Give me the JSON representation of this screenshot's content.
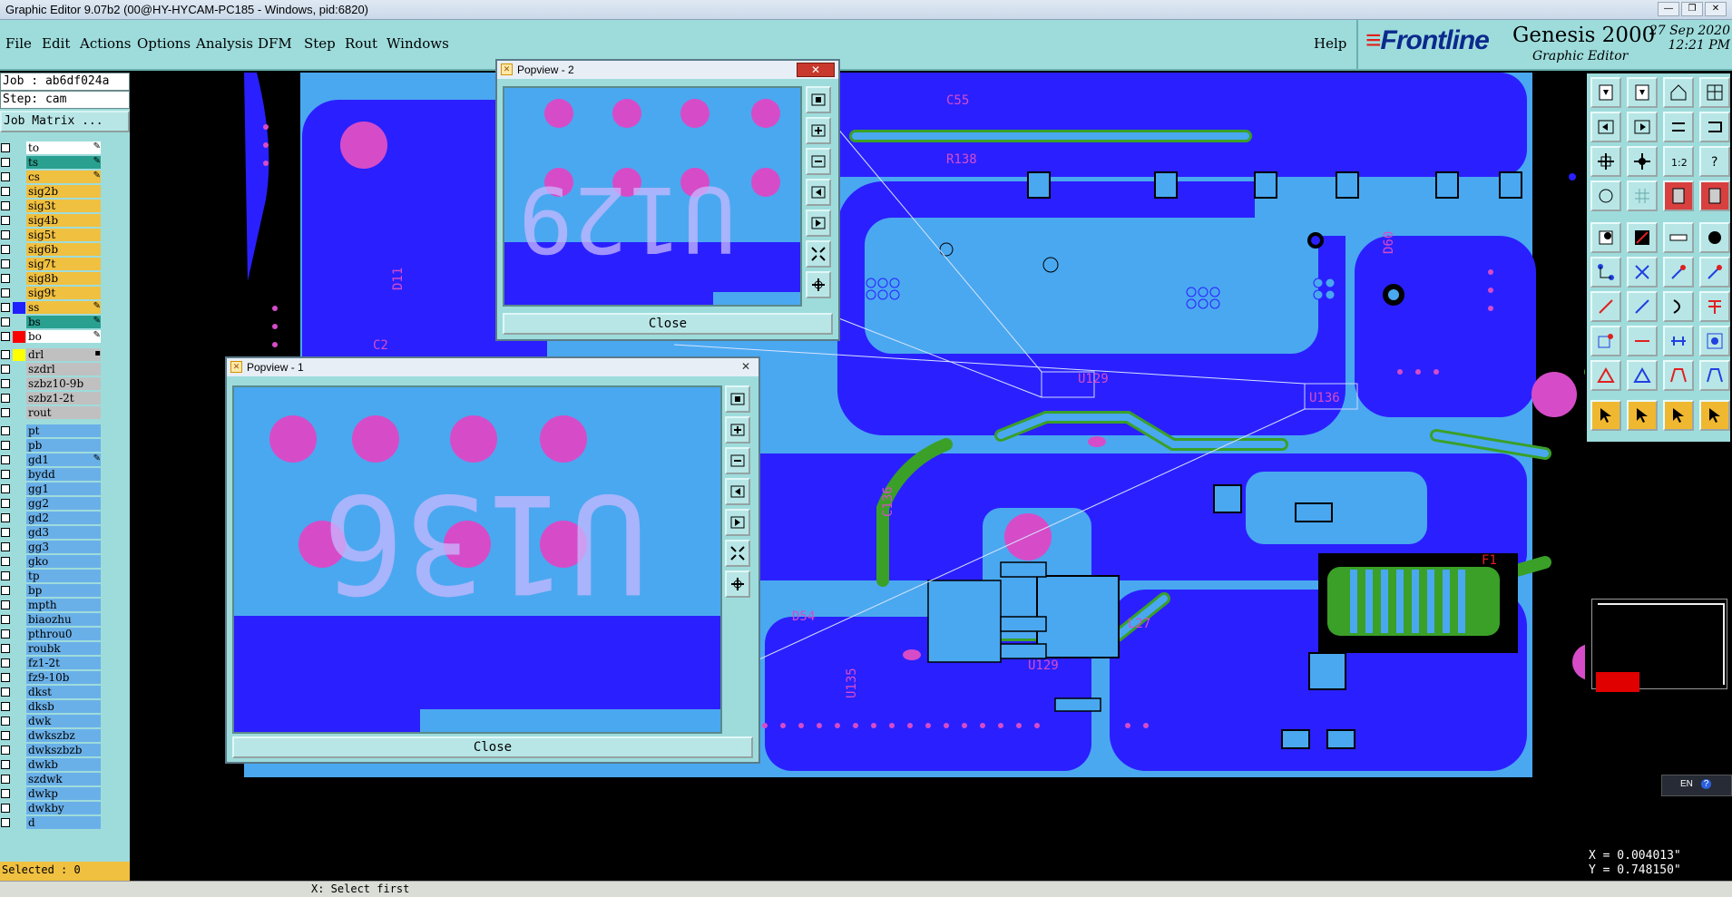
{
  "window_title": "Graphic Editor 9.07b2 (00@HY-HYCAM-PC185 - Windows, pid:6820)",
  "menu": {
    "file": "File",
    "edit": "Edit",
    "actions": "Actions",
    "options": "Options",
    "analysis": "Analysis",
    "dfm": "DFM",
    "step": "Step",
    "rout": "Rout",
    "windows": "Windows",
    "help": "Help"
  },
  "brand": {
    "logo_a": "Fr",
    "logo_b": "ontline",
    "product": "Genesis 2000",
    "subtitle": "Graphic Editor",
    "date": "27 Sep 2020",
    "time": "12:21 PM"
  },
  "left": {
    "job": "Job : ab6df024a",
    "step": "Step: cam",
    "job_matrix": "Job Matrix ...",
    "selected": "Selected : 0"
  },
  "layers": [
    {
      "name": "to",
      "swatch": "",
      "bg": "#ffffff",
      "mark": "✎"
    },
    {
      "name": "ts",
      "swatch": "",
      "bg": "#2aa090",
      "mark": "✎"
    },
    {
      "name": "cs",
      "swatch": "",
      "bg": "#f0c040",
      "mark": "✎"
    },
    {
      "name": "sig2b",
      "swatch": "",
      "bg": "#f0c040",
      "mark": ""
    },
    {
      "name": "sig3t",
      "swatch": "",
      "bg": "#f0c040",
      "mark": ""
    },
    {
      "name": "sig4b",
      "swatch": "",
      "bg": "#f0c040",
      "mark": ""
    },
    {
      "name": "sig5t",
      "swatch": "",
      "bg": "#f0c040",
      "mark": ""
    },
    {
      "name": "sig6b",
      "swatch": "",
      "bg": "#f0c040",
      "mark": ""
    },
    {
      "name": "sig7t",
      "swatch": "",
      "bg": "#f0c040",
      "mark": ""
    },
    {
      "name": "sig8b",
      "swatch": "",
      "bg": "#f0c040",
      "mark": ""
    },
    {
      "name": "sig9t",
      "swatch": "",
      "bg": "#f0c040",
      "mark": ""
    },
    {
      "name": "ss",
      "swatch": "#2020ff",
      "bg": "#f0c040",
      "mark": "✎"
    },
    {
      "name": "bs",
      "swatch": "",
      "bg": "#2aa090",
      "mark": "✎"
    },
    {
      "name": "bo",
      "swatch": "#ff0000",
      "bg": "#ffffff",
      "mark": "✎"
    },
    {
      "name": "drl",
      "swatch": "#ffff00",
      "bg": "#c0c0c0",
      "mark": "▪"
    },
    {
      "name": "szdrl",
      "swatch": "",
      "bg": "#c0c0c0",
      "mark": ""
    },
    {
      "name": "szbz10-9b",
      "swatch": "",
      "bg": "#c0c0c0",
      "mark": ""
    },
    {
      "name": "szbz1-2t",
      "swatch": "",
      "bg": "#c0c0c0",
      "mark": ""
    },
    {
      "name": "rout",
      "swatch": "",
      "bg": "#c0c0c0",
      "mark": ""
    },
    {
      "name": "pt",
      "swatch": "",
      "bg": "#6ab0e8",
      "mark": ""
    },
    {
      "name": "pb",
      "swatch": "",
      "bg": "#6ab0e8",
      "mark": ""
    },
    {
      "name": "gd1",
      "swatch": "",
      "bg": "#6ab0e8",
      "mark": "✎"
    },
    {
      "name": "bydd",
      "swatch": "",
      "bg": "#6ab0e8",
      "mark": ""
    },
    {
      "name": "gg1",
      "swatch": "",
      "bg": "#6ab0e8",
      "mark": ""
    },
    {
      "name": "gg2",
      "swatch": "",
      "bg": "#6ab0e8",
      "mark": ""
    },
    {
      "name": "gd2",
      "swatch": "",
      "bg": "#6ab0e8",
      "mark": ""
    },
    {
      "name": "gd3",
      "swatch": "",
      "bg": "#6ab0e8",
      "mark": ""
    },
    {
      "name": "gg3",
      "swatch": "",
      "bg": "#6ab0e8",
      "mark": ""
    },
    {
      "name": "gko",
      "swatch": "",
      "bg": "#6ab0e8",
      "mark": ""
    },
    {
      "name": "tp",
      "swatch": "",
      "bg": "#6ab0e8",
      "mark": ""
    },
    {
      "name": "bp",
      "swatch": "",
      "bg": "#6ab0e8",
      "mark": ""
    },
    {
      "name": "mpth",
      "swatch": "",
      "bg": "#6ab0e8",
      "mark": ""
    },
    {
      "name": "biaozhu",
      "swatch": "",
      "bg": "#6ab0e8",
      "mark": ""
    },
    {
      "name": "pthrou0",
      "swatch": "",
      "bg": "#6ab0e8",
      "mark": ""
    },
    {
      "name": "roubk",
      "swatch": "",
      "bg": "#6ab0e8",
      "mark": ""
    },
    {
      "name": "fz1-2t",
      "swatch": "",
      "bg": "#6ab0e8",
      "mark": ""
    },
    {
      "name": "fz9-10b",
      "swatch": "",
      "bg": "#6ab0e8",
      "mark": ""
    },
    {
      "name": "dkst",
      "swatch": "",
      "bg": "#6ab0e8",
      "mark": ""
    },
    {
      "name": "dksb",
      "swatch": "",
      "bg": "#6ab0e8",
      "mark": ""
    },
    {
      "name": "dwk",
      "swatch": "",
      "bg": "#6ab0e8",
      "mark": ""
    },
    {
      "name": "dwkszbz",
      "swatch": "",
      "bg": "#6ab0e8",
      "mark": ""
    },
    {
      "name": "dwkszbzb",
      "swatch": "",
      "bg": "#6ab0e8",
      "mark": ""
    },
    {
      "name": "dwkb",
      "swatch": "",
      "bg": "#6ab0e8",
      "mark": ""
    },
    {
      "name": "szdwk",
      "swatch": "",
      "bg": "#6ab0e8",
      "mark": ""
    },
    {
      "name": "dwkp",
      "swatch": "",
      "bg": "#6ab0e8",
      "mark": ""
    },
    {
      "name": "dwkby",
      "swatch": "",
      "bg": "#6ab0e8",
      "mark": ""
    },
    {
      "name": "d",
      "swatch": "",
      "bg": "#6ab0e8",
      "mark": ""
    }
  ],
  "popview1": {
    "title": "Popview - 1",
    "close": "Close",
    "label": "U136"
  },
  "popview2": {
    "title": "Popview - 2",
    "close": "Close",
    "label": "U129"
  },
  "board_labels": {
    "c55": "C55",
    "r138": "R138",
    "d60": "D60",
    "d11": "D11",
    "c2": "C2",
    "c136": "C136",
    "d54": "D54",
    "u129": "U129",
    "u135": "U135",
    "l27": "L27",
    "f1": "F1"
  },
  "ime": "EN",
  "coords": {
    "x": "X = 0.004013\"",
    "y": "Y = 0.748150\""
  },
  "status": "X:   Select first"
}
